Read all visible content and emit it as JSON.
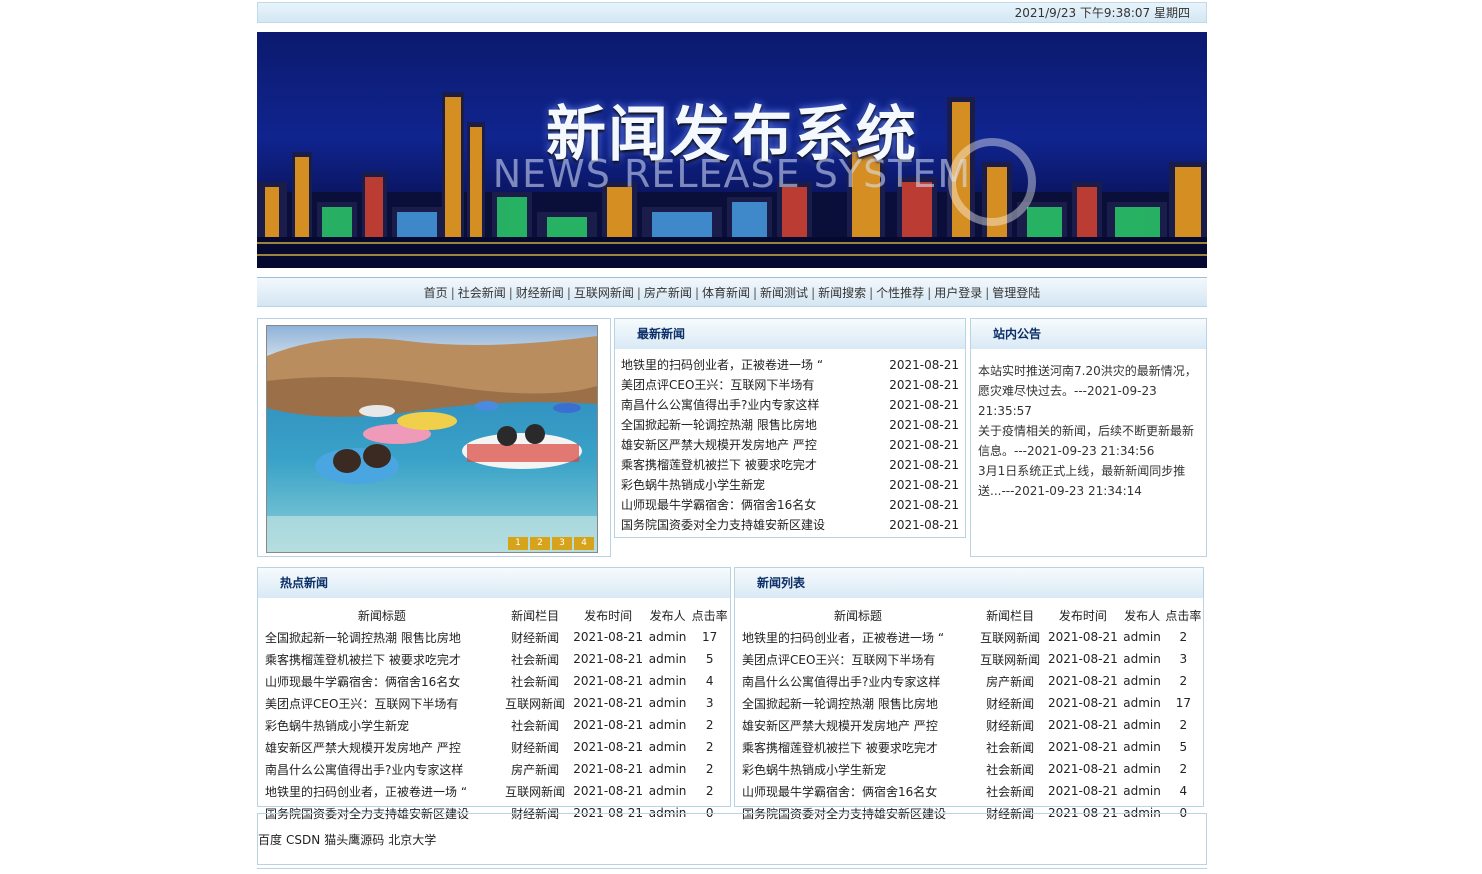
{
  "datetime": "2021/9/23 下午9:38:07   星期四",
  "banner": {
    "title": "新闻发布系统",
    "subtitle": "NEWS RELEASE SYSTEM"
  },
  "nav": {
    "items": [
      "首页",
      "社会新闻",
      "财经新闻",
      "互联网新闻",
      "房产新闻",
      "体育新闻",
      "新闻测试",
      "新闻搜索",
      "个性推荐",
      "用户登录",
      "管理登陆"
    ]
  },
  "slider": {
    "pages": [
      "1",
      "2",
      "3",
      "4"
    ]
  },
  "latest": {
    "heading": "最新新闻",
    "items": [
      {
        "title": "地铁里的扫码创业者，正被卷进一场 “",
        "date": "2021-08-21"
      },
      {
        "title": "美团点评CEO王兴：互联网下半场有",
        "date": "2021-08-21"
      },
      {
        "title": "南昌什么公寓值得出手?业内专家这样",
        "date": "2021-08-21"
      },
      {
        "title": "全国掀起新一轮调控热潮 限售比房地",
        "date": "2021-08-21"
      },
      {
        "title": "雄安新区严禁大规模开发房地产 严控",
        "date": "2021-08-21"
      },
      {
        "title": "乘客携榴莲登机被拦下 被要求吃完才",
        "date": "2021-08-21"
      },
      {
        "title": "彩色蜗牛热销成小学生新宠",
        "date": "2021-08-21"
      },
      {
        "title": "山师现最牛学霸宿舍：俩宿舍16名女",
        "date": "2021-08-21"
      },
      {
        "title": "国务院国资委对全力支持雄安新区建设",
        "date": "2021-08-21"
      }
    ]
  },
  "notice": {
    "heading": "站内公告",
    "items": [
      "本站实时推送河南7.20洪灾的最新情况，愿灾难尽快过去。---2021-09-23 21:35:57",
      "关于疫情相关的新闻，后续不断更新最新信息。---2021-09-23 21:34:56",
      "3月1日系统正式上线，最新新闻同步推送...---2021-09-23 21:34:14"
    ]
  },
  "columns": {
    "title": "新闻标题",
    "category": "新闻栏目",
    "date": "发布时间",
    "publisher": "发布人",
    "hits": "点击率"
  },
  "hot": {
    "heading": "热点新闻",
    "rows": [
      {
        "title": "全国掀起新一轮调控热潮 限售比房地",
        "category": "财经新闻",
        "date": "2021-08-21",
        "publisher": "admin",
        "hits": "17"
      },
      {
        "title": "乘客携榴莲登机被拦下 被要求吃完才",
        "category": "社会新闻",
        "date": "2021-08-21",
        "publisher": "admin",
        "hits": "5"
      },
      {
        "title": "山师现最牛学霸宿舍：俩宿舍16名女",
        "category": "社会新闻",
        "date": "2021-08-21",
        "publisher": "admin",
        "hits": "4"
      },
      {
        "title": "美团点评CEO王兴：互联网下半场有",
        "category": "互联网新闻",
        "date": "2021-08-21",
        "publisher": "admin",
        "hits": "3"
      },
      {
        "title": "彩色蜗牛热销成小学生新宠",
        "category": "社会新闻",
        "date": "2021-08-21",
        "publisher": "admin",
        "hits": "2"
      },
      {
        "title": "雄安新区严禁大规模开发房地产 严控",
        "category": "财经新闻",
        "date": "2021-08-21",
        "publisher": "admin",
        "hits": "2"
      },
      {
        "title": "南昌什么公寓值得出手?业内专家这样",
        "category": "房产新闻",
        "date": "2021-08-21",
        "publisher": "admin",
        "hits": "2"
      },
      {
        "title": "地铁里的扫码创业者，正被卷进一场 “",
        "category": "互联网新闻",
        "date": "2021-08-21",
        "publisher": "admin",
        "hits": "2"
      },
      {
        "title": "国务院国资委对全力支持雄安新区建设",
        "category": "财经新闻",
        "date": "2021-08-21",
        "publisher": "admin",
        "hits": "0"
      }
    ]
  },
  "list": {
    "heading": "新闻列表",
    "rows": [
      {
        "title": "地铁里的扫码创业者，正被卷进一场 “",
        "category": "互联网新闻",
        "date": "2021-08-21",
        "publisher": "admin",
        "hits": "2"
      },
      {
        "title": "美团点评CEO王兴：互联网下半场有",
        "category": "互联网新闻",
        "date": "2021-08-21",
        "publisher": "admin",
        "hits": "3"
      },
      {
        "title": "南昌什么公寓值得出手?业内专家这样",
        "category": "房产新闻",
        "date": "2021-08-21",
        "publisher": "admin",
        "hits": "2"
      },
      {
        "title": "全国掀起新一轮调控热潮 限售比房地",
        "category": "财经新闻",
        "date": "2021-08-21",
        "publisher": "admin",
        "hits": "17"
      },
      {
        "title": "雄安新区严禁大规模开发房地产 严控",
        "category": "财经新闻",
        "date": "2021-08-21",
        "publisher": "admin",
        "hits": "2"
      },
      {
        "title": "乘客携榴莲登机被拦下 被要求吃完才",
        "category": "社会新闻",
        "date": "2021-08-21",
        "publisher": "admin",
        "hits": "5"
      },
      {
        "title": "彩色蜗牛热销成小学生新宠",
        "category": "社会新闻",
        "date": "2021-08-21",
        "publisher": "admin",
        "hits": "2"
      },
      {
        "title": "山师现最牛学霸宿舍：俩宿舍16名女",
        "category": "社会新闻",
        "date": "2021-08-21",
        "publisher": "admin",
        "hits": "4"
      },
      {
        "title": "国务院国资委对全力支持雄安新区建设",
        "category": "财经新闻",
        "date": "2021-08-21",
        "publisher": "admin",
        "hits": "0"
      }
    ]
  },
  "footer": {
    "links": [
      "百度",
      "CSDN",
      "猫头鹰源码",
      "北京大学"
    ]
  }
}
